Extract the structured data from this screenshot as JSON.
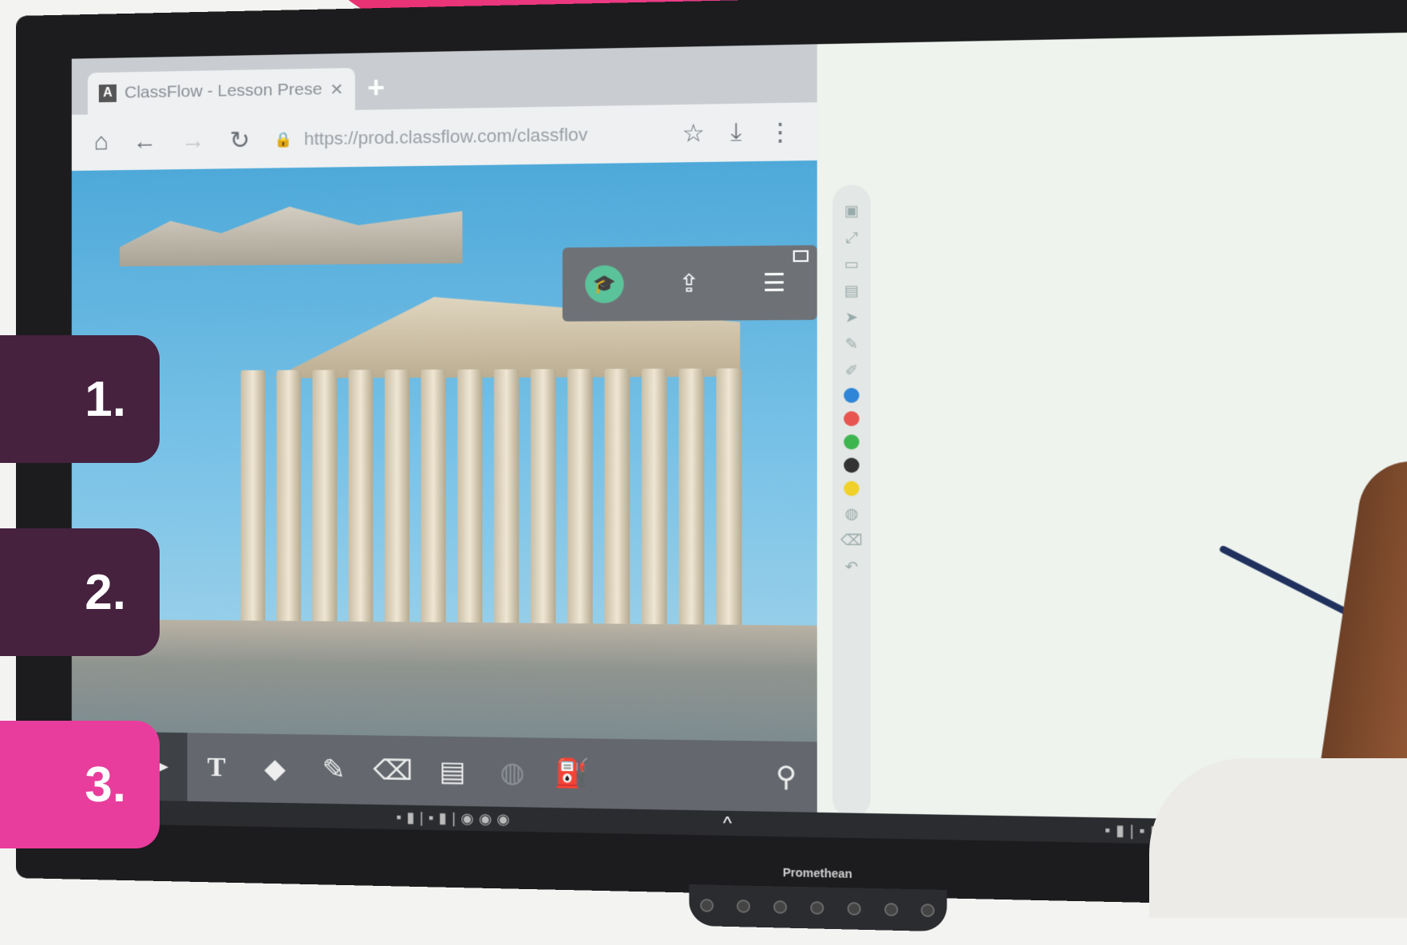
{
  "browser": {
    "tab_title": "ClassFlow - Lesson Presen",
    "tab_close": "✕",
    "new_tab": "+",
    "url": "https://prod.classflow.com/classflov",
    "nav": {
      "home": "⌂",
      "back": "←",
      "forward": "→",
      "reload": "↻",
      "star": "☆",
      "download": "⤓",
      "menu": "⋮"
    }
  },
  "floating_toolbar": {
    "minimize": ""
  },
  "bottom_toolbar": {
    "tools": [
      "→",
      "➤",
      "T",
      "◆",
      "✎",
      "⌫",
      "▤",
      "◍",
      "⚲"
    ]
  },
  "monitor": {
    "brand": "Promethean",
    "chevron": "^"
  },
  "labels": [
    "1.",
    "2.",
    "3."
  ],
  "colors": {
    "pink": "#e83d9c",
    "plum": "#46223f",
    "bar": "#64686e",
    "green": "#5bc39a"
  }
}
